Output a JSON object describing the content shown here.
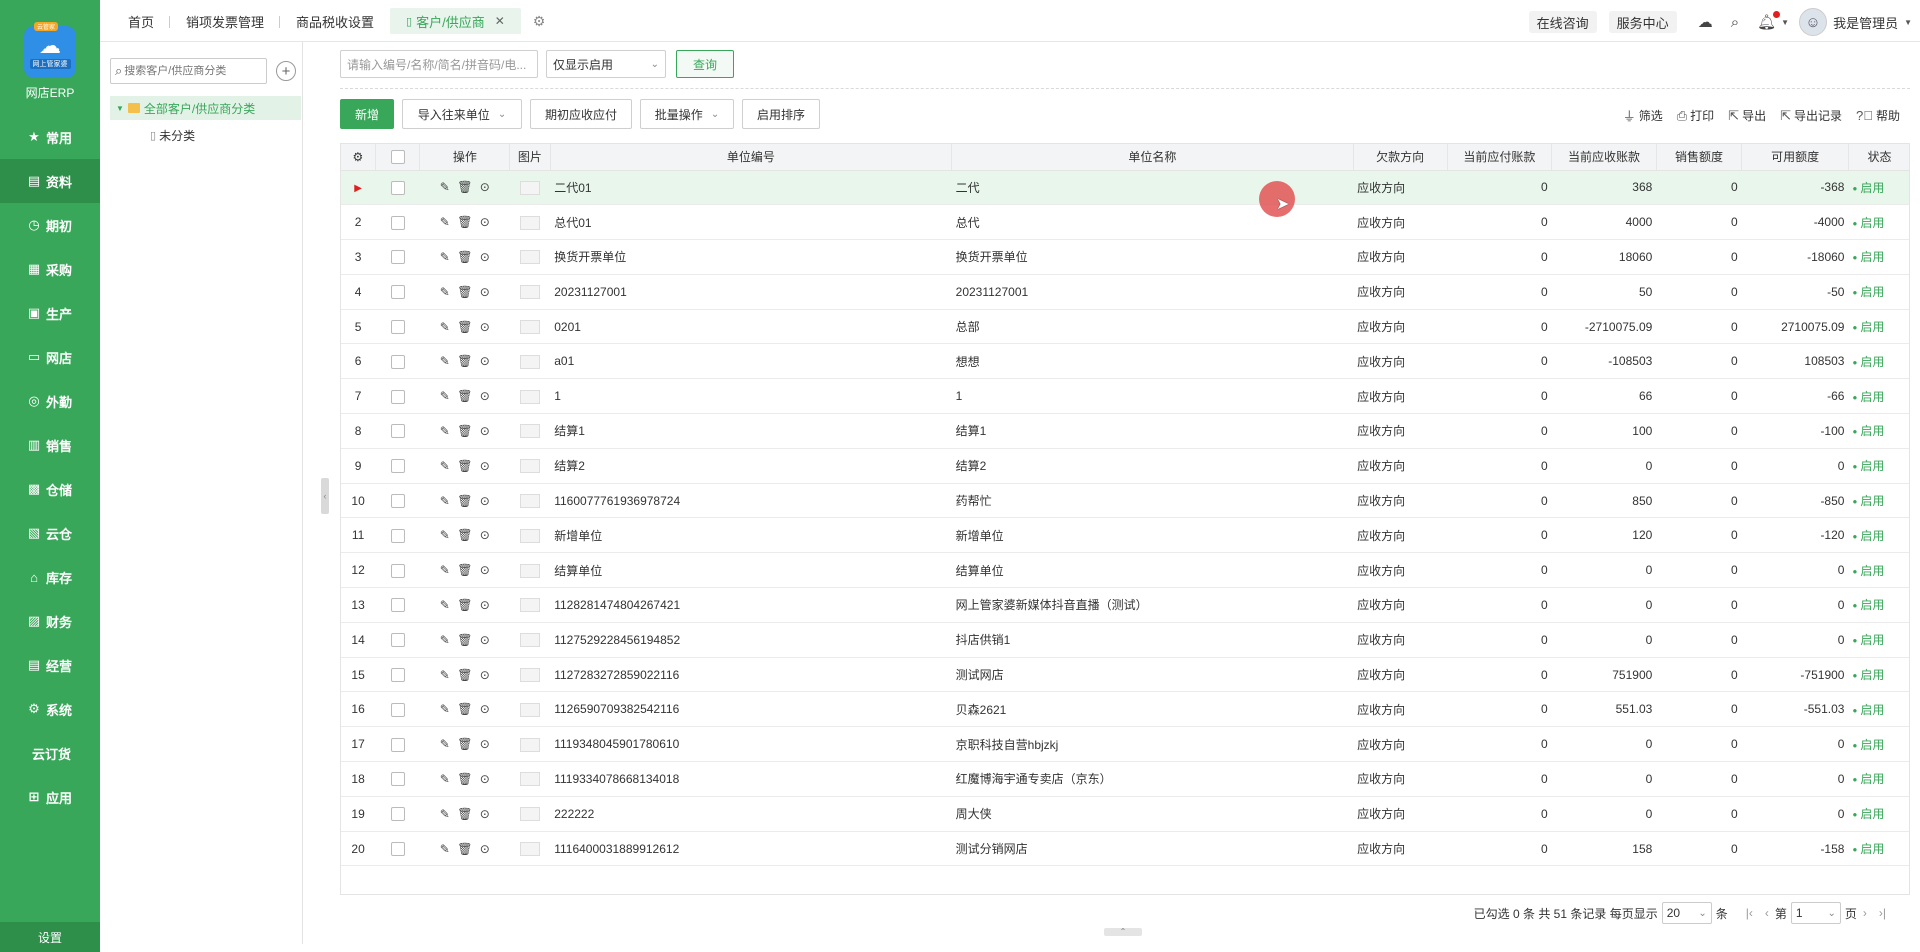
{
  "app": {
    "brand": "网店ERP",
    "logo_tag": "云管家",
    "logo_sub": "网上管家婆",
    "settings_label": "设置"
  },
  "nav": [
    {
      "label": "常用",
      "icon": "star-icon"
    },
    {
      "label": "资料",
      "icon": "doc-icon"
    },
    {
      "label": "期初",
      "icon": "clock-icon"
    },
    {
      "label": "采购",
      "icon": "cart-icon"
    },
    {
      "label": "生产",
      "icon": "factory-icon"
    },
    {
      "label": "网店",
      "icon": "shop-icon"
    },
    {
      "label": "外勤",
      "icon": "location-icon"
    },
    {
      "label": "销售",
      "icon": "chart-icon"
    },
    {
      "label": "仓储",
      "icon": "warehouse-icon"
    },
    {
      "label": "云仓",
      "icon": "cloud-warehouse-icon"
    },
    {
      "label": "库存",
      "icon": "home-icon"
    },
    {
      "label": "财务",
      "icon": "finance-icon"
    },
    {
      "label": "经营",
      "icon": "business-icon"
    },
    {
      "label": "系统",
      "icon": "gear-icon"
    },
    {
      "label": "云订货",
      "icon": ""
    },
    {
      "label": "应用",
      "icon": "plus-icon"
    }
  ],
  "tabs": [
    "首页",
    "销项发票管理",
    "商品税收设置",
    "客户/供应商"
  ],
  "top_right": {
    "consult": "在线咨询",
    "service": "服务中心",
    "user": "我是管理员"
  },
  "tree": {
    "search_placeholder": "搜索客户/供应商分类",
    "root": "全部客户/供应商分类",
    "child": "未分类"
  },
  "filters": {
    "search_placeholder": "请输入编号/名称/简名/拼音码/电...",
    "status_select": "仅显示启用",
    "query_label": "查询"
  },
  "toolbar": {
    "new": "新增",
    "import": "导入往来单位",
    "opening": "期初应收应付",
    "batch": "批量操作",
    "sort": "启用排序",
    "filter": "筛选",
    "print": "打印",
    "export": "导出",
    "export_log": "导出记录",
    "help": "帮助"
  },
  "columns": [
    "操作",
    "图片",
    "单位编号",
    "单位名称",
    "欠款方向",
    "当前应付账款",
    "当前应收账款",
    "销售额度",
    "可用额度",
    "状态"
  ],
  "rows": [
    {
      "no": "",
      "code": "二代01",
      "name": "二代",
      "dir": "应收方向",
      "ap": "0",
      "ar": "368",
      "quota": "0",
      "avail": "-368",
      "status": "启用"
    },
    {
      "no": "2",
      "code": "总代01",
      "name": "总代",
      "dir": "应收方向",
      "ap": "0",
      "ar": "4000",
      "quota": "0",
      "avail": "-4000",
      "status": "启用"
    },
    {
      "no": "3",
      "code": "换货开票单位",
      "name": "换货开票单位",
      "dir": "应收方向",
      "ap": "0",
      "ar": "18060",
      "quota": "0",
      "avail": "-18060",
      "status": "启用"
    },
    {
      "no": "4",
      "code": "20231127001",
      "name": "20231127001",
      "dir": "应收方向",
      "ap": "0",
      "ar": "50",
      "quota": "0",
      "avail": "-50",
      "status": "启用"
    },
    {
      "no": "5",
      "code": "0201",
      "name": "总部",
      "dir": "应收方向",
      "ap": "0",
      "ar": "-2710075.09",
      "quota": "0",
      "avail": "2710075.09",
      "status": "启用"
    },
    {
      "no": "6",
      "code": "a01",
      "name": "想想",
      "dir": "应收方向",
      "ap": "0",
      "ar": "-108503",
      "quota": "0",
      "avail": "108503",
      "status": "启用"
    },
    {
      "no": "7",
      "code": "1",
      "name": "1",
      "dir": "应收方向",
      "ap": "0",
      "ar": "66",
      "quota": "0",
      "avail": "-66",
      "status": "启用"
    },
    {
      "no": "8",
      "code": "结算1",
      "name": "结算1",
      "dir": "应收方向",
      "ap": "0",
      "ar": "100",
      "quota": "0",
      "avail": "-100",
      "status": "启用"
    },
    {
      "no": "9",
      "code": "结算2",
      "name": "结算2",
      "dir": "应收方向",
      "ap": "0",
      "ar": "0",
      "quota": "0",
      "avail": "0",
      "status": "启用"
    },
    {
      "no": "10",
      "code": "1160077761936978724",
      "name": "药帮忙",
      "dir": "应收方向",
      "ap": "0",
      "ar": "850",
      "quota": "0",
      "avail": "-850",
      "status": "启用"
    },
    {
      "no": "11",
      "code": "新增单位",
      "name": "新增单位",
      "dir": "应收方向",
      "ap": "0",
      "ar": "120",
      "quota": "0",
      "avail": "-120",
      "status": "启用"
    },
    {
      "no": "12",
      "code": "结算单位",
      "name": "结算单位",
      "dir": "应收方向",
      "ap": "0",
      "ar": "0",
      "quota": "0",
      "avail": "0",
      "status": "启用"
    },
    {
      "no": "13",
      "code": "1128281474804267421",
      "name": "网上管家婆新媒体抖音直播（测试）",
      "dir": "应收方向",
      "ap": "0",
      "ar": "0",
      "quota": "0",
      "avail": "0",
      "status": "启用"
    },
    {
      "no": "14",
      "code": "1127529228456194852",
      "name": "抖店供销1",
      "dir": "应收方向",
      "ap": "0",
      "ar": "0",
      "quota": "0",
      "avail": "0",
      "status": "启用"
    },
    {
      "no": "15",
      "code": "1127283272859022116",
      "name": "测试网店",
      "dir": "应收方向",
      "ap": "0",
      "ar": "751900",
      "quota": "0",
      "avail": "-751900",
      "status": "启用"
    },
    {
      "no": "16",
      "code": "1126590709382542116",
      "name": "贝森2621",
      "dir": "应收方向",
      "ap": "0",
      "ar": "551.03",
      "quota": "0",
      "avail": "-551.03",
      "status": "启用"
    },
    {
      "no": "17",
      "code": "1119348045901780610",
      "name": "京职科技自营hbjzkj",
      "dir": "应收方向",
      "ap": "0",
      "ar": "0",
      "quota": "0",
      "avail": "0",
      "status": "启用"
    },
    {
      "no": "18",
      "code": "1119334078668134018",
      "name": "红魔博海宇通专卖店（京东）",
      "dir": "应收方向",
      "ap": "0",
      "ar": "0",
      "quota": "0",
      "avail": "0",
      "status": "启用"
    },
    {
      "no": "19",
      "code": "222222",
      "name": "周大侠",
      "dir": "应收方向",
      "ap": "0",
      "ar": "0",
      "quota": "0",
      "avail": "0",
      "status": "启用"
    },
    {
      "no": "20",
      "code": "1116400031889912612",
      "name": "测试分销网店",
      "dir": "应收方向",
      "ap": "0",
      "ar": "158",
      "quota": "0",
      "avail": "-158",
      "status": "启用"
    }
  ],
  "pager": {
    "summary": "已勾选 0 条 共 51 条记录 每页显示",
    "page_size": "20",
    "unit": "条",
    "page_prefix": "第",
    "page": "1",
    "page_suffix": "页"
  },
  "colors": {
    "accent": "#39a75a",
    "sidebar": "#39a75a",
    "selected_row": "#e8f6ec"
  }
}
